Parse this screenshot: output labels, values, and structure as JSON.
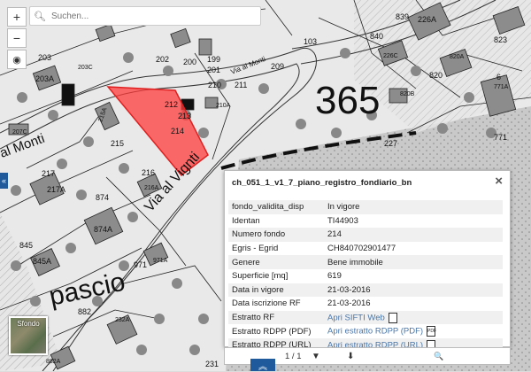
{
  "search": {
    "placeholder": "Suchen..."
  },
  "controls": {
    "zoom_in": "+",
    "zoom_out": "−",
    "locate": "◉"
  },
  "basemap": {
    "label": "Sfondo"
  },
  "map_labels": {
    "n203": "203",
    "n203A": "203A",
    "n203C": "203C",
    "n202": "202",
    "n200": "200",
    "n199": "199",
    "n201": "201",
    "n209": "209",
    "n210": "210",
    "n211": "211",
    "n212": "212",
    "n213": "213",
    "n214": "214",
    "n215": "215",
    "n215A": "215A",
    "n216": "216",
    "n216A": "216A",
    "n217": "217",
    "n217A": "217A",
    "n874": "874",
    "n874A": "874A",
    "n845": "845",
    "n845A": "845A",
    "n971": "971",
    "n971A": "971A",
    "n882": "882",
    "n232A": "232A",
    "n882A": "882A",
    "n231": "231",
    "n103": "103",
    "n365": "365",
    "n839": "839",
    "n226A": "226A",
    "n823": "823",
    "n840": "840",
    "n226C": "226C",
    "n820A": "820A",
    "n820": "820",
    "n820B": "820B",
    "n6": "6",
    "n771A": "771A",
    "n227": "227",
    "n771": "771",
    "n207C": "207C",
    "n210A": "210A",
    "street_monti_top": "Via al Monti",
    "street_monti_left": "al Monti",
    "street_vignti": "Via al Vignti",
    "place_pascio": "pascio"
  },
  "popup": {
    "title": "ch_051_1_v1_7_piano_registro_fondiario_bn",
    "close": "×",
    "rows": [
      {
        "key": "fondo_validita_disp",
        "value": "In vigore"
      },
      {
        "key": "Identan",
        "value": "TI44903"
      },
      {
        "key": "Numero fondo",
        "value": "214"
      },
      {
        "key": "Egris - Egrid",
        "value": "CH840702901477"
      },
      {
        "key": "Genere",
        "value": "Bene immobile"
      },
      {
        "key": "Superficie [mq]",
        "value": "619"
      },
      {
        "key": "Data in vigore",
        "value": "21-03-2016"
      },
      {
        "key": "Data iscrizione RF",
        "value": "21-03-2016"
      },
      {
        "key": "Estratto RF",
        "value": "Apri SIFTI Web"
      },
      {
        "key": "Estratto RDPP (PDF)",
        "value": "Apri estratto RDPP (PDF)"
      },
      {
        "key": "Estratto RDPP (URL)",
        "value": "Apri estratto RDPP (URL)"
      }
    ],
    "pdf_icon_text": "PDF"
  },
  "toolbar": {
    "pager": "1 / 1",
    "filter": "▼",
    "download": "⬇",
    "zoom": "🔍"
  },
  "colors": {
    "highlight": "#ff3b3b",
    "accent": "#1e5a9c",
    "link": "#4a76a8"
  }
}
